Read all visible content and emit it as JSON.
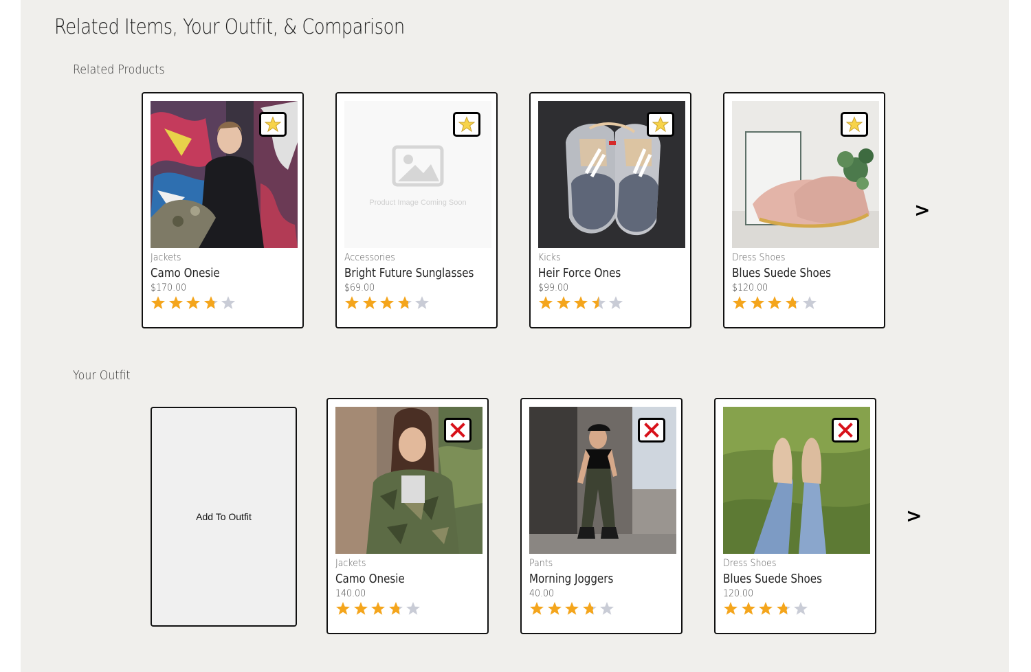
{
  "page": {
    "title": "Related Items, Your Outfit, & Comparison"
  },
  "related": {
    "heading": "Related Products",
    "next_label": ">",
    "items": [
      {
        "category": "Jackets",
        "name": "Camo Onesie",
        "price": "$170.00",
        "rating": 3.75,
        "image": "guy-graffiti-photo"
      },
      {
        "category": "Accessories",
        "name": "Bright Future Sunglasses",
        "price": "$69.00",
        "rating": 3.75,
        "image": "placeholder",
        "placeholder_text": "Product Image Coming Soon"
      },
      {
        "category": "Kicks",
        "name": "Heir Force Ones",
        "price": "$99.00",
        "rating": 3.5,
        "image": "sneakers-photo"
      },
      {
        "category": "Dress Shoes",
        "name": "Blues Suede Shoes",
        "price": "$120.00",
        "rating": 3.75,
        "image": "dress-shoes-photo"
      }
    ]
  },
  "outfit": {
    "heading": "Your Outfit",
    "add_label": "Add To Outfit",
    "next_label": ">",
    "items": [
      {
        "category": "Jackets",
        "name": "Camo Onesie",
        "price": "140.00",
        "rating": 3.75,
        "image": "woman-camo-jacket-photo"
      },
      {
        "category": "Pants",
        "name": "Morning Joggers",
        "price": "40.00",
        "rating": 3.75,
        "image": "woman-joggers-photo"
      },
      {
        "category": "Dress Shoes",
        "name": "Blues Suede Shoes",
        "price": "120.00",
        "rating": 3.75,
        "image": "legs-on-grass-photo"
      }
    ]
  },
  "colors": {
    "panel_bg": "#f0efec",
    "star_filled": "#f4a51c",
    "star_empty": "#c9ccd6",
    "remove_x": "#d8111a"
  }
}
